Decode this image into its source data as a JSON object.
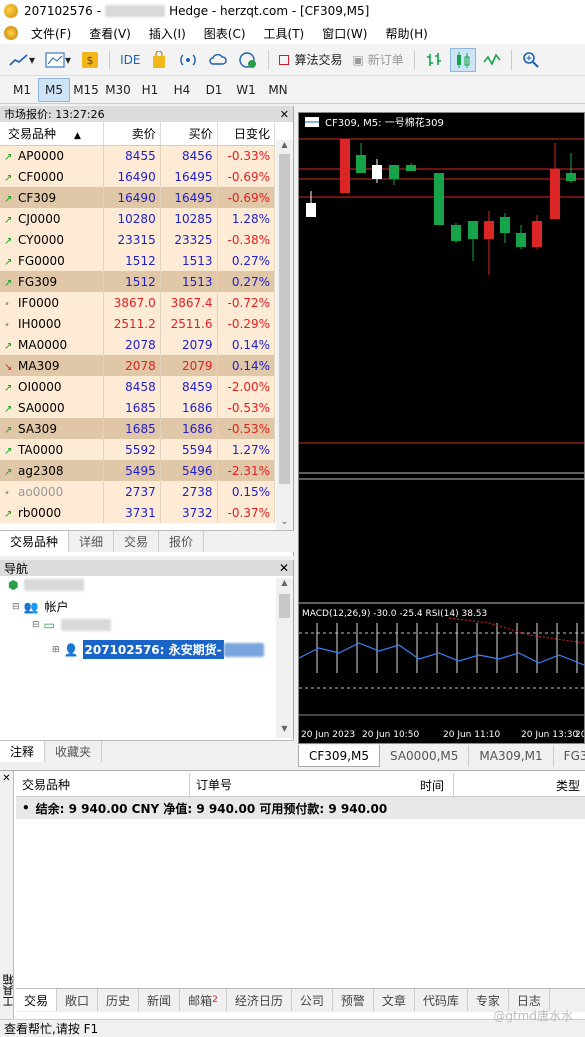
{
  "titlebar": {
    "account": "207102576",
    "separator": "-",
    "server": "Hedge - herzqt.com - [CF309,M5]"
  },
  "menu": [
    "文件(F)",
    "查看(V)",
    "插入(I)",
    "图表(C)",
    "工具(T)",
    "窗口(W)",
    "帮助(H)"
  ],
  "toolbar": {
    "ide": "IDE",
    "algo_trading": "算法交易",
    "new_order": "新订单"
  },
  "timeframes": [
    "M1",
    "M5",
    "M15",
    "M30",
    "H1",
    "H4",
    "D1",
    "W1",
    "MN"
  ],
  "active_timeframe": "M5",
  "market_watch": {
    "title": "市场报价: 13:27:26",
    "columns": [
      "交易品种",
      "卖价",
      "买价",
      "日变化"
    ],
    "rows": [
      {
        "symbol": "AP0000",
        "bid": "8455",
        "ask": "8456",
        "change": "-0.33%",
        "arrow": "up",
        "shade": "light"
      },
      {
        "symbol": "CF0000",
        "bid": "16490",
        "ask": "16495",
        "change": "-0.69%",
        "arrow": "up",
        "shade": "light"
      },
      {
        "symbol": "CF309",
        "bid": "16490",
        "ask": "16495",
        "change": "-0.69%",
        "arrow": "up",
        "shade": "dark"
      },
      {
        "symbol": "CJ0000",
        "bid": "10280",
        "ask": "10285",
        "change": "1.28%",
        "arrow": "up",
        "shade": "light"
      },
      {
        "symbol": "CY0000",
        "bid": "23315",
        "ask": "23325",
        "change": "-0.38%",
        "arrow": "up",
        "shade": "light"
      },
      {
        "symbol": "FG0000",
        "bid": "1512",
        "ask": "1513",
        "change": "0.27%",
        "arrow": "up",
        "shade": "light"
      },
      {
        "symbol": "FG309",
        "bid": "1512",
        "ask": "1513",
        "change": "0.27%",
        "arrow": "up",
        "shade": "dark"
      },
      {
        "symbol": "IF0000",
        "bid": "3867.0",
        "ask": "3867.4",
        "change": "-0.72%",
        "arrow": "dot",
        "shade": "light",
        "red_prices": true
      },
      {
        "symbol": "IH0000",
        "bid": "2511.2",
        "ask": "2511.6",
        "change": "-0.29%",
        "arrow": "dot",
        "shade": "light",
        "red_prices": true
      },
      {
        "symbol": "MA0000",
        "bid": "2078",
        "ask": "2079",
        "change": "0.14%",
        "arrow": "up",
        "shade": "light"
      },
      {
        "symbol": "MA309",
        "bid": "2078",
        "ask": "2079",
        "change": "0.14%",
        "arrow": "down",
        "shade": "dark",
        "red_prices": true
      },
      {
        "symbol": "OI0000",
        "bid": "8458",
        "ask": "8459",
        "change": "-2.00%",
        "arrow": "up",
        "shade": "light"
      },
      {
        "symbol": "SA0000",
        "bid": "1685",
        "ask": "1686",
        "change": "-0.53%",
        "arrow": "up",
        "shade": "light"
      },
      {
        "symbol": "SA309",
        "bid": "1685",
        "ask": "1686",
        "change": "-0.53%",
        "arrow": "up",
        "shade": "dark"
      },
      {
        "symbol": "TA0000",
        "bid": "5592",
        "ask": "5594",
        "change": "1.27%",
        "arrow": "up",
        "shade": "light"
      },
      {
        "symbol": "ag2308",
        "bid": "5495",
        "ask": "5496",
        "change": "-2.31%",
        "arrow": "up",
        "shade": "dark"
      },
      {
        "symbol": "ao0000",
        "bid": "2737",
        "ask": "2738",
        "change": "0.15%",
        "arrow": "dot",
        "shade": "light",
        "grey_symbol": true
      },
      {
        "symbol": "rb0000",
        "bid": "3731",
        "ask": "3732",
        "change": "-0.37%",
        "arrow": "up",
        "shade": "light"
      }
    ],
    "tabs": [
      "交易品种",
      "详细",
      "交易",
      "报价"
    ]
  },
  "navigator": {
    "title": "导航",
    "accounts_label": "帐户",
    "selected_account": "207102576: 永安期货-",
    "tabs": [
      "注释",
      "收藏夹"
    ]
  },
  "chart": {
    "header": "CF309, M5:  一号棉花309",
    "indicator_label": "MACD(12,26,9) -30.0 -25.4 RSI(14) 38.53",
    "time_labels": [
      "20 Jun 2023",
      "20 Jun 10:50",
      "20 Jun 11:10",
      "20 Jun 13:30",
      "20 Jun"
    ],
    "bull_color": "#16a34a",
    "bear_color": "#dc2626",
    "tabs": [
      "CF309,M5",
      "SA0000,M5",
      "MA309,M1",
      "FG3"
    ]
  },
  "terminal": {
    "vertical_title": "工具箱",
    "columns": [
      "交易品种",
      "订单号",
      "时间",
      "类型"
    ],
    "balance_line": "结余: 9 940.00 CNY  净值: 9 940.00  可用预付款: 9 940.00",
    "tabs": [
      "交易",
      "敞口",
      "历史",
      "新闻",
      "邮箱",
      "经济日历",
      "公司",
      "预警",
      "文章",
      "代码库",
      "专家",
      "日志"
    ],
    "mail_badge": "2"
  },
  "status": "查看帮忙,请按 F1",
  "watermark": "@gtmd唐水水"
}
